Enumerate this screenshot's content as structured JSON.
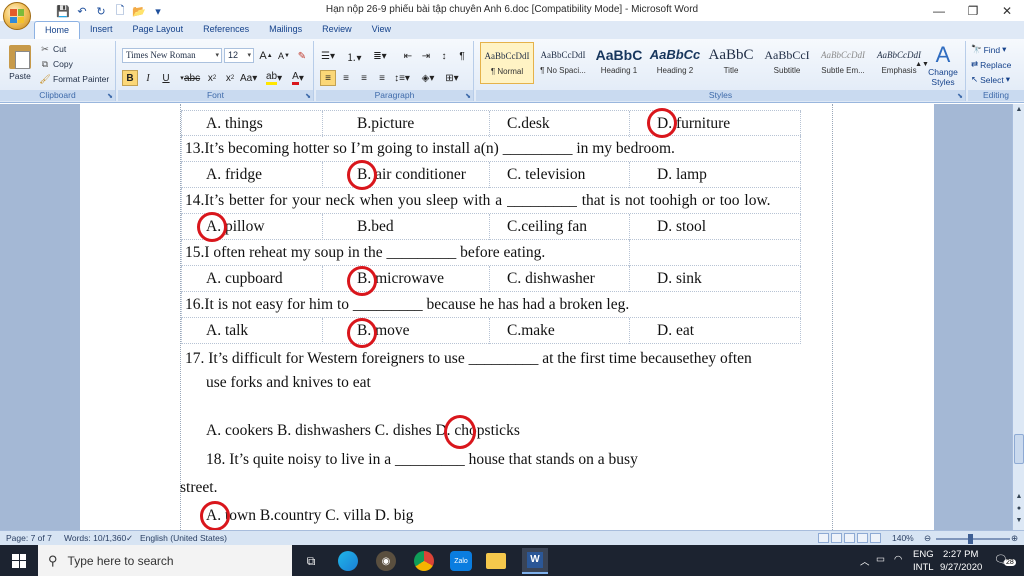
{
  "window": {
    "title": "Hạn nộp 26-9 phiếu bài tập chuyên Anh 6.doc [Compatibility Mode] - Microsoft Word",
    "minimize": "—",
    "maximize": "❐",
    "close": "✕"
  },
  "tabs": [
    "Home",
    "Insert",
    "Page Layout",
    "References",
    "Mailings",
    "Review",
    "View"
  ],
  "ribbon": {
    "clipboard": {
      "label": "Clipboard",
      "paste": "Paste",
      "cut": "Cut",
      "copy": "Copy",
      "format_painter": "Format Painter"
    },
    "font": {
      "label": "Font",
      "name": "Times New Roman",
      "size": "12"
    },
    "paragraph": {
      "label": "Paragraph"
    },
    "styles": {
      "label": "Styles",
      "items": [
        {
          "preview": "AaBbCcDdI",
          "name": "¶ Normal"
        },
        {
          "preview": "AaBbCcDdI",
          "name": "¶ No Spaci..."
        },
        {
          "preview": "AaBbC",
          "name": "Heading 1"
        },
        {
          "preview": "AaBbCc",
          "name": "Heading 2"
        },
        {
          "preview": "AaBbC",
          "name": "Title"
        },
        {
          "preview": "AaBbCcI",
          "name": "Subtitle"
        },
        {
          "preview": "AaBbCcDdI",
          "name": "Subtle Em..."
        },
        {
          "preview": "AaBbCcDdI",
          "name": "Emphasis"
        }
      ],
      "change_styles": "Change Styles"
    },
    "editing": {
      "label": "Editing",
      "find": "Find",
      "replace": "Replace",
      "select": "Select"
    }
  },
  "document": {
    "rows": [
      {
        "kind": "opts",
        "a": "A. things",
        "b": "B.picture",
        "c": "C.desk",
        "d": "D. furniture"
      },
      {
        "kind": "q",
        "text": "13.It’s becoming hotter so I’m going to install a(n) _________ in my bedroom."
      },
      {
        "kind": "opts",
        "a": "A. fridge",
        "b": "B. air conditioner",
        "c": "C. television",
        "d": "D. lamp"
      },
      {
        "kind": "q",
        "text": "14.It’s better for your neck when you sleep with a _________ that is not toohigh or too low."
      },
      {
        "kind": "opts",
        "a": "A. pillow",
        "b": "B.bed",
        "c": "C.ceiling fan",
        "d": "D. stool"
      },
      {
        "kind": "q",
        "text": "15.I often reheat my soup in the _________ before eating."
      },
      {
        "kind": "opts",
        "a": "A. cupboard",
        "b": "B. microwave",
        "c": "C. dishwasher",
        "d": "D. sink"
      },
      {
        "kind": "q",
        "text": "16.It is not easy for him to _________ because he has had a broken leg."
      },
      {
        "kind": "opts",
        "a": "A. talk",
        "b": "B. move",
        "c": "C.make",
        "d": "D. eat"
      }
    ],
    "q17_line1": "17. It’s difficult for Western foreigners to use _________ at the first time becausethey often",
    "q17_line2": "use forks and knives to eat",
    "q17_options": "A. cookers B. dishwashers C. dishes D. chopsticks",
    "q18_line1": "18. It’s quite noisy to live in a _________ house that stands on a busy",
    "q18_line2": "street.",
    "q18_options": "A. town B.country C. villa D. big"
  },
  "statusbar": {
    "page": "Page: 7 of 7",
    "words": "Words: 10/1,360",
    "language": "English (United States)",
    "zoom": "140%"
  },
  "taskbar": {
    "search_placeholder": "Type here to search",
    "lang_top": "ENG",
    "lang_bottom": "INTL",
    "time": "2:27 PM",
    "date": "9/27/2020",
    "notifications": "28"
  },
  "colors": {
    "answer_circle": "#d9161c",
    "ribbon_text": "#15428b",
    "taskbar": "#1c2330"
  }
}
